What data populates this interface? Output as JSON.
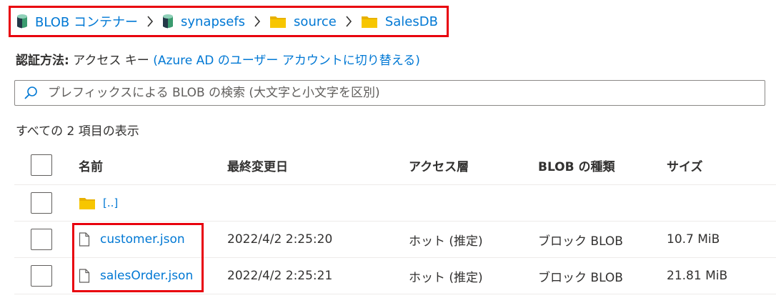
{
  "breadcrumb": {
    "items": [
      {
        "label": "BLOB コンテナー",
        "icon": "container-icon"
      },
      {
        "label": "synapsefs",
        "icon": "container-icon"
      },
      {
        "label": "source",
        "icon": "folder-icon"
      },
      {
        "label": "SalesDB",
        "icon": "folder-icon"
      }
    ],
    "separator_icon": "chevron-right-icon"
  },
  "auth": {
    "label": "認証方法:",
    "value": "アクセス キー",
    "switch_link": "(Azure AD のユーザー アカウントに切り替える)"
  },
  "search": {
    "placeholder": "プレフィックスによる BLOB の検索 (大文字と小文字を区別)",
    "value": ""
  },
  "item_count": "すべての 2 項目の表示",
  "table": {
    "columns": [
      "名前",
      "最終変更日",
      "アクセス層",
      "BLOB の種類",
      "サイズ"
    ],
    "rows": [
      {
        "name": "[..]",
        "icon": "folder-icon",
        "modified": "",
        "tier": "",
        "type": "",
        "size": ""
      },
      {
        "name": "customer.json",
        "icon": "file-icon",
        "modified": "2022/4/2 2:25:20",
        "tier": "ホット (推定)",
        "type": "ブロック BLOB",
        "size": "10.7 MiB"
      },
      {
        "name": "salesOrder.json",
        "icon": "file-icon",
        "modified": "2022/4/2 2:25:21",
        "tier": "ホット (推定)",
        "type": "ブロック BLOB",
        "size": "21.81 MiB"
      }
    ]
  },
  "colors": {
    "link": "#0078d4",
    "highlight": "#e8000d",
    "folder": "#f7c600",
    "text": "#323130"
  }
}
